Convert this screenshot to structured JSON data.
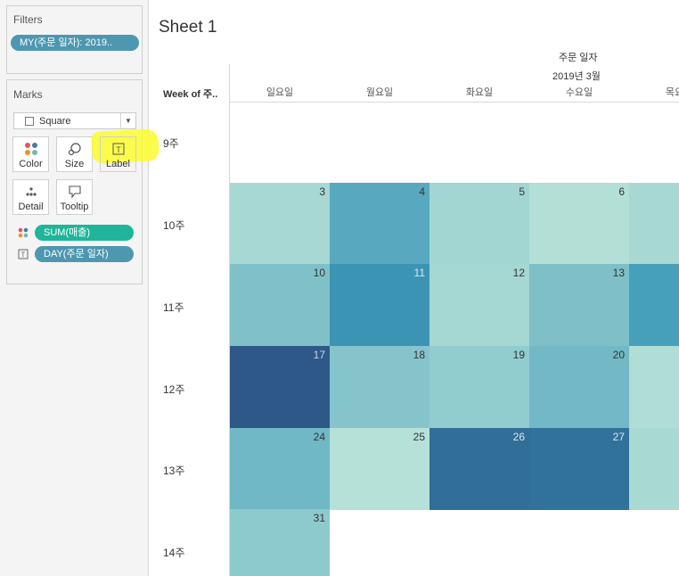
{
  "filters": {
    "title": "Filters",
    "pill": "MY(주문 일자): 2019.."
  },
  "marks": {
    "title": "Marks",
    "mark_type": "Square",
    "buttons": {
      "color": "Color",
      "size": "Size",
      "label": "Label",
      "detail": "Detail",
      "tooltip": "Tooltip"
    },
    "fields": [
      {
        "label": "SUM(매출)",
        "color": "#1fb59a",
        "icon": "color-dots-icon"
      },
      {
        "label": "DAY(주문 일자)",
        "color": "#4d97b1",
        "icon": "text-label-icon"
      }
    ]
  },
  "sheet": {
    "title": "Sheet 1",
    "column_header": "주문 일자",
    "month_header": "2019년 3월",
    "row_header": "Week of 주..",
    "days": [
      "일요일",
      "월요일",
      "화요일",
      "수요일",
      "목요일"
    ],
    "weeks": [
      "9주",
      "10주",
      "11주",
      "12주",
      "13주",
      "14주"
    ],
    "cells": [
      {
        "week": 1,
        "day": 0,
        "num": "3",
        "color": "#a8d8d3",
        "num_color": "#333"
      },
      {
        "week": 1,
        "day": 1,
        "num": "4",
        "color": "#58a9c0",
        "num_color": "#333"
      },
      {
        "week": 1,
        "day": 2,
        "num": "5",
        "color": "#a2d6d2",
        "num_color": "#333"
      },
      {
        "week": 1,
        "day": 3,
        "num": "6",
        "color": "#b3dfd6",
        "num_color": "#333"
      },
      {
        "week": 1,
        "day": 4,
        "num": "",
        "color": "#a8d8d3",
        "num_color": "#333"
      },
      {
        "week": 2,
        "day": 0,
        "num": "10",
        "color": "#80c1c9",
        "num_color": "#333"
      },
      {
        "week": 2,
        "day": 1,
        "num": "11",
        "color": "#3c94b4",
        "num_color": "#dbe9f0"
      },
      {
        "week": 2,
        "day": 2,
        "num": "12",
        "color": "#a5d7d3",
        "num_color": "#333"
      },
      {
        "week": 2,
        "day": 3,
        "num": "13",
        "color": "#7ebfc8",
        "num_color": "#333"
      },
      {
        "week": 2,
        "day": 4,
        "num": "",
        "color": "#46a0bb",
        "num_color": "#333"
      },
      {
        "week": 3,
        "day": 0,
        "num": "17",
        "color": "#2e5887",
        "num_color": "#c9d3e0"
      },
      {
        "week": 3,
        "day": 1,
        "num": "18",
        "color": "#86c4cc",
        "num_color": "#333"
      },
      {
        "week": 3,
        "day": 2,
        "num": "19",
        "color": "#91ccce",
        "num_color": "#333"
      },
      {
        "week": 3,
        "day": 3,
        "num": "20",
        "color": "#73b8c6",
        "num_color": "#333"
      },
      {
        "week": 3,
        "day": 4,
        "num": "",
        "color": "#b0ddd6",
        "num_color": "#333"
      },
      {
        "week": 4,
        "day": 0,
        "num": "24",
        "color": "#71b8c6",
        "num_color": "#333"
      },
      {
        "week": 4,
        "day": 1,
        "num": "25",
        "color": "#b6e1d8",
        "num_color": "#333"
      },
      {
        "week": 4,
        "day": 2,
        "num": "26",
        "color": "#326f98",
        "num_color": "#dbe5ee"
      },
      {
        "week": 4,
        "day": 3,
        "num": "27",
        "color": "#31729b",
        "num_color": "#dbe5ee"
      },
      {
        "week": 4,
        "day": 4,
        "num": "",
        "color": "#a9d9d3",
        "num_color": "#333"
      },
      {
        "week": 5,
        "day": 0,
        "num": "31",
        "color": "#8dcacd",
        "num_color": "#333"
      }
    ]
  }
}
